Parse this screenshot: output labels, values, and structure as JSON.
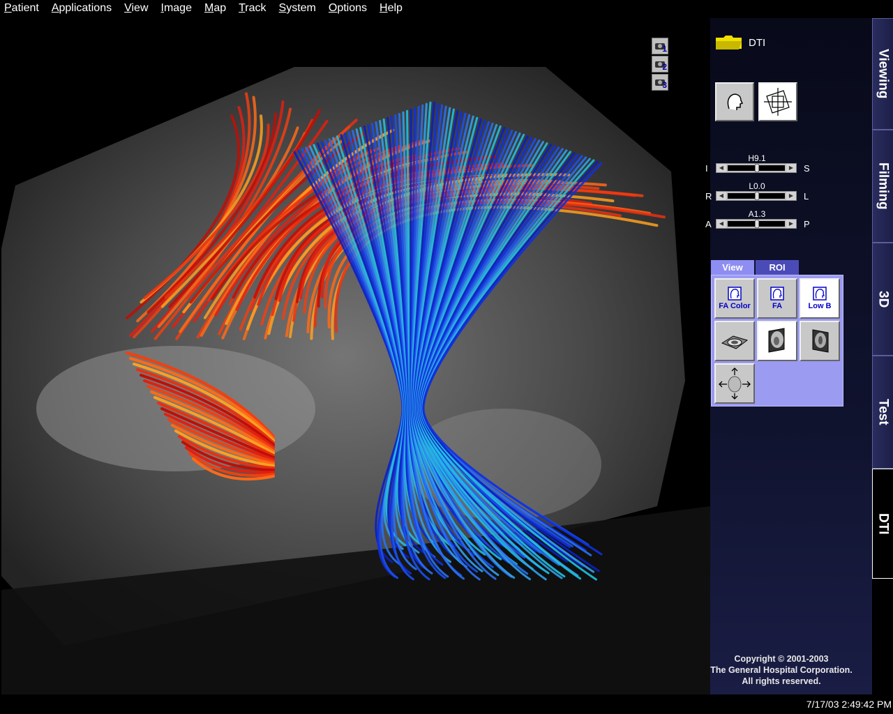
{
  "menu": [
    "Patient",
    "Applications",
    "View",
    "Image",
    "Map",
    "Track",
    "System",
    "Options",
    "Help"
  ],
  "camera_buttons": [
    {
      "number": "1",
      "icon": "camera-icon"
    },
    {
      "number": "2",
      "icon": "camera-icon"
    },
    {
      "number": "3",
      "icon": "camera-icon"
    }
  ],
  "folder": {
    "label": "DTI",
    "icon": "folder-icon",
    "color": "#f0e000"
  },
  "view_buttons": [
    {
      "icon": "head-outline-icon"
    },
    {
      "icon": "plane-intersect-icon"
    }
  ],
  "sliders": [
    {
      "value": "H9.1",
      "left": "I",
      "right": "S",
      "position": 0.5
    },
    {
      "value": "L0.0",
      "left": "R",
      "right": "L",
      "position": 0.5
    },
    {
      "value": "A1.3",
      "left": "A",
      "right": "P",
      "position": 0.5
    }
  ],
  "tool_tabs": [
    {
      "label": "View",
      "active": true
    },
    {
      "label": "ROI",
      "active": false
    }
  ],
  "tool_buttons": [
    {
      "label": "FA Color",
      "icon": "head-icon"
    },
    {
      "label": "FA",
      "icon": "head-icon"
    },
    {
      "label": "Low B",
      "icon": "head-icon"
    },
    {
      "label": "",
      "icon": "axial-slice-icon"
    },
    {
      "label": "",
      "icon": "sagittal-slice-icon"
    },
    {
      "label": "",
      "icon": "coronal-slice-icon"
    },
    {
      "label": "",
      "icon": "rotate-head-icon"
    }
  ],
  "side_tabs": [
    {
      "label": "Viewing",
      "active": false
    },
    {
      "label": "Filming",
      "active": false
    },
    {
      "label": "3D",
      "active": false
    },
    {
      "label": "Test",
      "active": false
    },
    {
      "label": "DTI",
      "active": true
    }
  ],
  "copyright": [
    "Copyright © 2001-2003",
    "The General Hospital Corporation.",
    "All rights reserved."
  ],
  "datetime": "7/17/03 2:49:42 PM",
  "colors": {
    "panel_tab_active": "#8d8df2",
    "panel_tab": "#4b4bb8",
    "panel_body": "#9b9bf2",
    "fiber_red": "#e02010",
    "fiber_blue": "#1030e0",
    "fiber_cyan": "#20c0e0"
  }
}
